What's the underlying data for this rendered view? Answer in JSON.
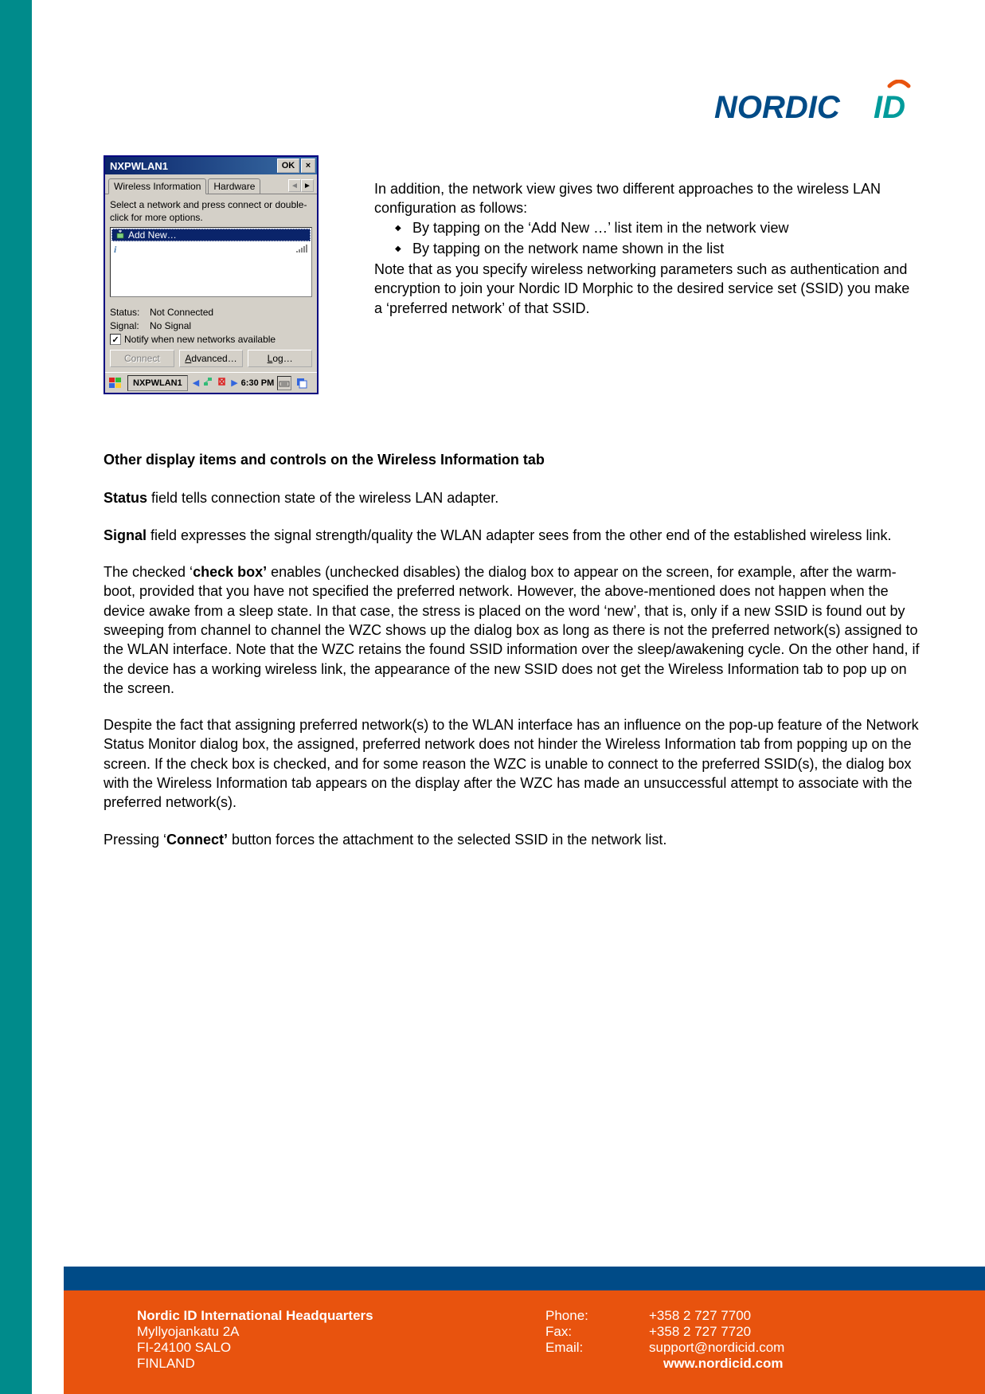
{
  "logo": {
    "text_part1": "NORDIC",
    "text_part2": "ID"
  },
  "wince": {
    "title": "NXPWLAN1",
    "ok": "OK",
    "close": "×",
    "tabs": {
      "t1": "Wireless Information",
      "t2": "Hardware"
    },
    "instruction": "Select a network and press connect or double-click for more options.",
    "add_new_label": "Add New…",
    "status_label": "Status:",
    "status_value": "Not Connected",
    "signal_label": "Signal:",
    "signal_value": "No Signal",
    "notify_label": "Notify when new networks available",
    "buttons": {
      "connect": "Connect",
      "advanced": "Advanced…",
      "log": "Log…"
    },
    "advanced_u": "A",
    "advanced_rest": "dvanced…",
    "log_u": "L",
    "log_rest": "og…",
    "taskbar": {
      "app": "NXPWLAN1",
      "time": "6:30 PM"
    }
  },
  "rcol": {
    "intro": "In addition, the network view gives two different approaches to the wireless LAN configuration as follows:",
    "bullet1": "By tapping on the ‘Add New …’ list item in the network view",
    "bullet2": "By tapping on the network name shown in the list",
    "note_b": "Note",
    "note_rest1": " that as you specify wireless networking parameters such as authentication and encryption to join your Nordic ID Morphic to the desired service set (SSID) you make a ‘",
    "note_b2": "preferred network",
    "note_rest2": "’ of that SSID."
  },
  "body": {
    "heading": "Other display items and controls on the Wireless Information tab",
    "p1_b": "Status",
    "p1_r": " field tells connection state of the wireless LAN adapter.",
    "p2_b": "Signal",
    "p2_r": " field expresses the signal strength/quality the WLAN adapter sees from the other end of the established wireless link.",
    "p3_pre": "The checked ‘",
    "p3_b": "check box’",
    "p3_post": " enables (unchecked disables) the dialog box to appear on the screen, for example, after the warm-boot, provided that you have not specified the preferred network. However, the above-mentioned does not happen when the device awake from a sleep state. In that case, the stress is placed on the word ‘new’, that is, only if a new SSID is found out by sweeping from channel to channel the WZC shows up the dialog box as long as there is not the preferred network(s) assigned to the WLAN interface. Note that the WZC retains the found SSID information over the sleep/awakening cycle. On the other hand, if the device has a working wireless link, the appearance of the new SSID does not get the Wireless Information tab to pop up on the screen.",
    "p4": "Despite the fact that assigning preferred network(s) to the WLAN interface has an influence on the pop-up feature of the Network Status Monitor dialog box, the assigned, preferred network does not hinder the Wireless Information tab from popping up on the screen. If the check box is checked, and for some reason the WZC is unable to connect to the preferred SSID(s), the dialog box with the Wireless Information tab appears on the display after the WZC has made an unsuccessful attempt to associate with the preferred network(s).",
    "p5_pre": "Pressing ‘",
    "p5_b": "Connect’",
    "p5_post": " button forces the attachment to the selected SSID in the network list."
  },
  "footer": {
    "hq_title": "Nordic ID International Headquarters",
    "addr1": "Myllyojankatu 2A",
    "addr2": "FI-24100 SALO",
    "addr3": "FINLAND",
    "phone_l": "Phone:",
    "fax_l": "Fax:",
    "email_l": "Email:",
    "phone_v": "+358 2 727 7700",
    "fax_v": "+358 2 727 7720",
    "email_v": "support@nordicid.com",
    "web": "www.nordicid.com"
  }
}
